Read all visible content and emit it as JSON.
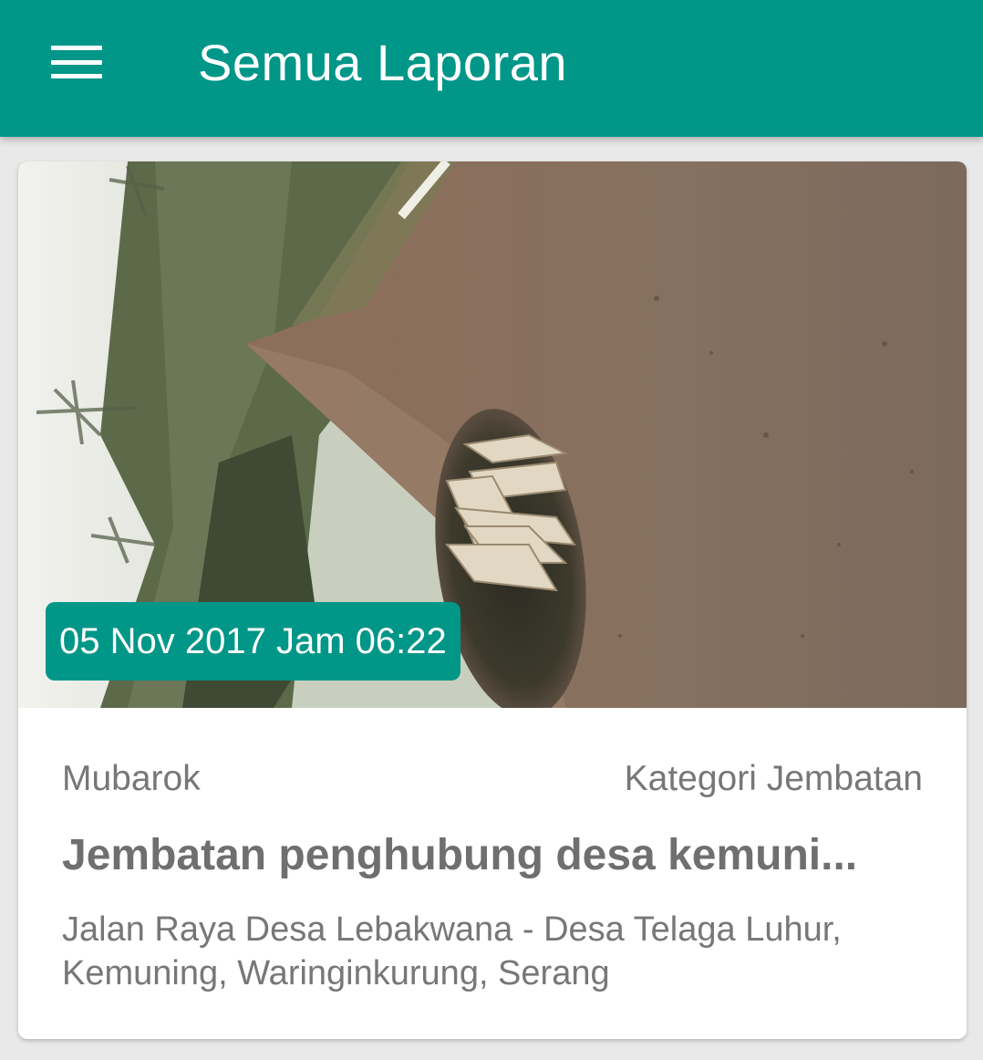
{
  "appbar": {
    "title": "Semua Laporan",
    "menu_icon": "hamburger-menu-icon",
    "color": "#009688"
  },
  "report": {
    "date": "05 Nov 2017 Jam 06:22",
    "reporter": "Mubarok",
    "category": "Kategori Jembatan",
    "title": "Jembatan penghubung desa kemuni...",
    "address": "Jalan Raya Desa Lebakwana - Desa Telaga Luhur, Kemuning, Waringinkurung, Serang",
    "photo_description": "rotated photo of a dirt road with a collapsed bridge hole and broken timber"
  },
  "colors": {
    "accent": "#009688",
    "background": "#e9e9e9",
    "card": "#ffffff",
    "secondary_text": "#777777"
  }
}
